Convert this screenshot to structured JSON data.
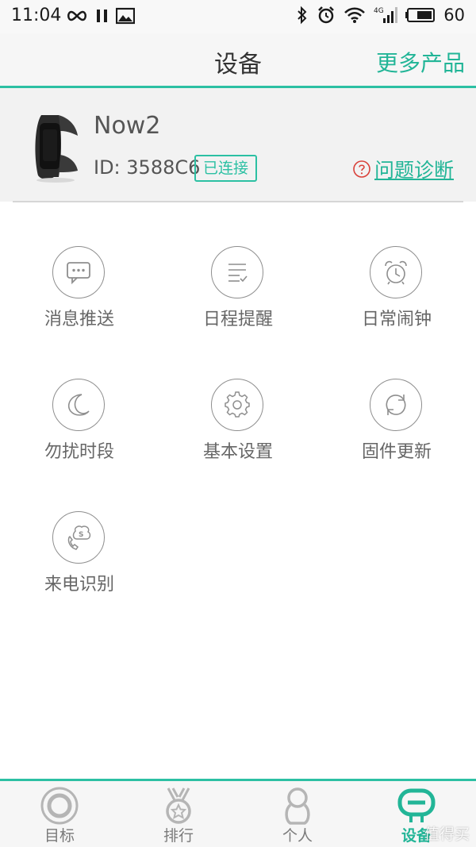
{
  "status_bar": {
    "time": "11:04",
    "network": "4G",
    "battery": "60"
  },
  "header": {
    "title": "设备",
    "more_products": "更多产品"
  },
  "device": {
    "name": "Now2",
    "id_text": "ID: 3588C6",
    "status": "已连接",
    "diagnose": "问题诊断"
  },
  "features": [
    {
      "label": "消息推送",
      "icon": "message-icon"
    },
    {
      "label": "日程提醒",
      "icon": "schedule-icon"
    },
    {
      "label": "日常闹钟",
      "icon": "alarm-clock-icon"
    },
    {
      "label": "勿扰时段",
      "icon": "moon-icon"
    },
    {
      "label": "基本设置",
      "icon": "gear-icon"
    },
    {
      "label": "固件更新",
      "icon": "refresh-icon"
    },
    {
      "label": "来电识别",
      "icon": "phone-call-icon"
    }
  ],
  "bottom_nav": [
    {
      "label": "目标",
      "icon": "target-icon",
      "active": false
    },
    {
      "label": "排行",
      "icon": "medal-icon",
      "active": false
    },
    {
      "label": "个人",
      "icon": "person-icon",
      "active": false
    },
    {
      "label": "设备",
      "icon": "band-icon",
      "active": true
    }
  ],
  "watermark": "值得买",
  "colors": {
    "accent": "#2cc0a3",
    "accent_text": "#22b597",
    "icon_gray": "#8e8e8e",
    "warning_red": "#d9413a"
  }
}
